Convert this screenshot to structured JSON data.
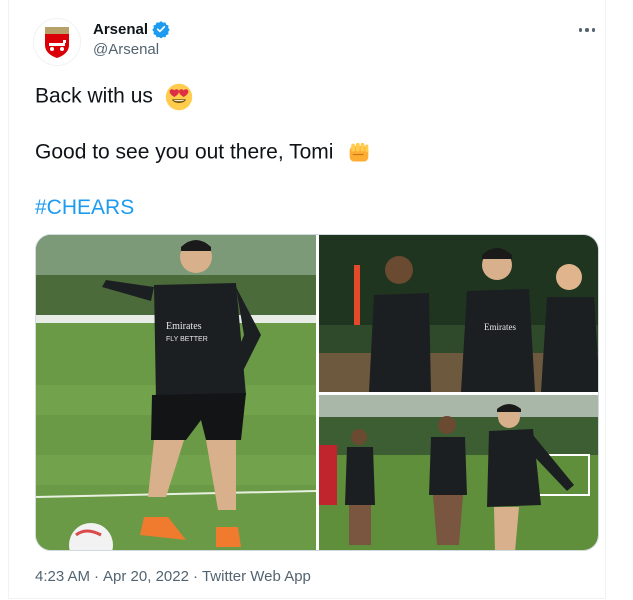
{
  "account": {
    "name": "Arsenal",
    "handle": "@Arsenal"
  },
  "tweet": {
    "line1": "Back with us",
    "line1_emoji": "heart-eyes-emoji",
    "line2": "Good to see you out there, Tomi",
    "line2_emoji": "fist-emoji",
    "hashtag": "#CHEARS"
  },
  "footer": {
    "time": "4:23 AM",
    "sep1": "·",
    "date": "Apr 20, 2022",
    "sep2": "·",
    "source": "Twitter Web App"
  },
  "colors": {
    "link": "#1d9bf0",
    "secondary_text": "#536471",
    "verified": "#1d9bf0",
    "arsenal_red": "#db0007"
  },
  "photo_kits": {
    "shirt_sponsor": "Emirates",
    "shirt_sponsor_sub": "FLY BETTER"
  }
}
